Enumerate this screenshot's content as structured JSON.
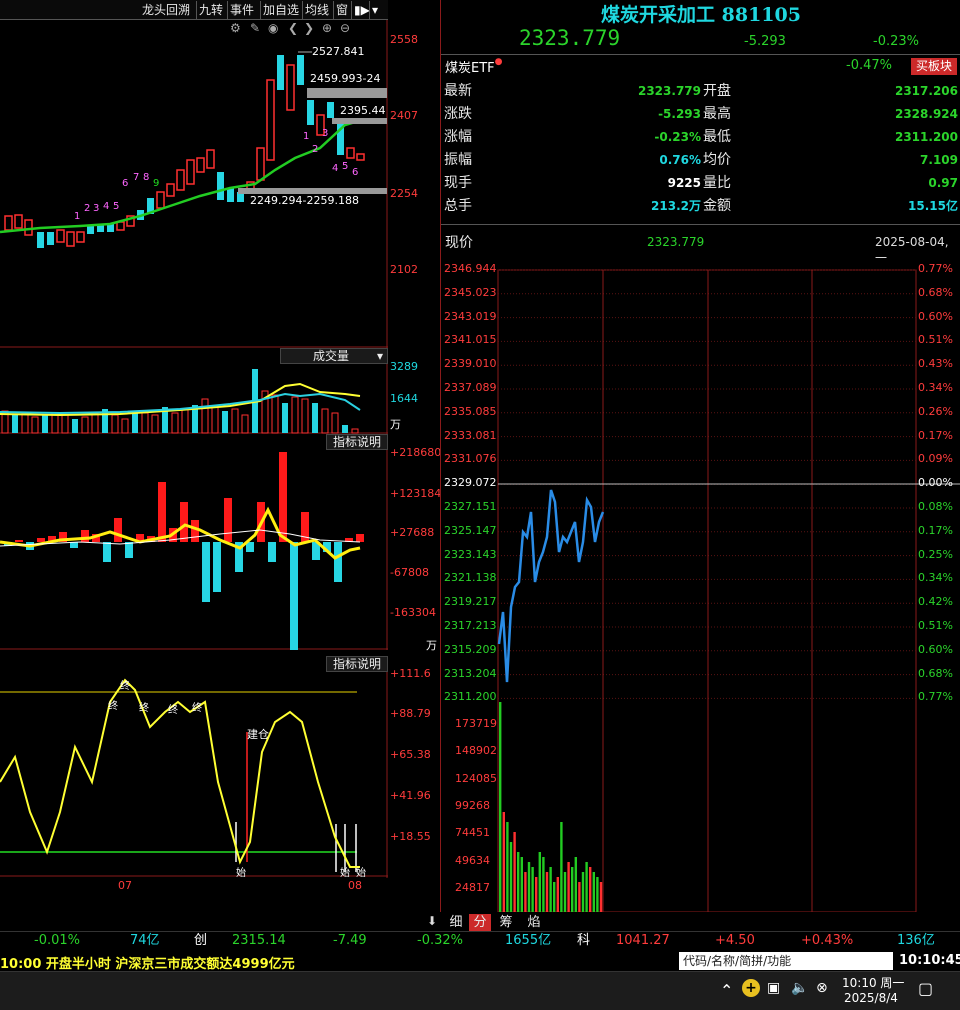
{
  "toolbar": {
    "buttons": [
      "龙头回溯",
      "九转",
      "事件",
      "加自选",
      "均线",
      "窗"
    ],
    "icons": [
      "gear-icon",
      "pen-icon",
      "eye-icon",
      "prev-icon",
      "next-icon",
      "zoom-in-icon",
      "zoom-out-icon"
    ]
  },
  "kline": {
    "price_axis": [
      "2558",
      "2407",
      "2254",
      "2102"
    ],
    "annotations": {
      "high": "2527.841",
      "box_top": "2459.993-24",
      "box_mid": "2395.44",
      "box_low": "2249.294-2259.188"
    },
    "nine_turn_labels": [
      "1",
      "2",
      "3",
      "4",
      "5",
      "6",
      "7",
      "8",
      "9",
      "1",
      "2",
      "3",
      "4",
      "5",
      "6"
    ]
  },
  "volume": {
    "title": "成交量",
    "axis": [
      "3289",
      "1644"
    ],
    "unit": "万"
  },
  "indicator1": {
    "title": "指标说明",
    "axis": [
      "+218680",
      "+123184",
      "+27688",
      "-67808",
      "-163304"
    ],
    "unit": "万"
  },
  "indicator2": {
    "title": "指标说明",
    "axis": [
      "+111.6",
      "+88.79",
      "+65.38",
      "+41.96",
      "+18.55"
    ],
    "marks": [
      "终",
      "终",
      "终",
      "终",
      "终",
      "建仓",
      "始",
      "始",
      "始"
    ]
  },
  "x_axis": [
    "07",
    "08"
  ],
  "quote": {
    "name": "煤炭开采加工 881105",
    "price": "2323.779",
    "change": "-5.293",
    "change_pct": "-0.23%",
    "etf_name": "煤炭ETF",
    "etf_pct": "-0.47%",
    "buy_block": "买板块",
    "rows": [
      {
        "l1": "最新",
        "v1": "2323.779",
        "c1": "green",
        "l2": "开盘",
        "v2": "2317.206",
        "c2": "green"
      },
      {
        "l1": "涨跌",
        "v1": "-5.293",
        "c1": "green",
        "l2": "最高",
        "v2": "2328.924",
        "c2": "green"
      },
      {
        "l1": "涨幅",
        "v1": "-0.23%",
        "c1": "green",
        "l2": "最低",
        "v2": "2311.200",
        "c2": "green"
      },
      {
        "l1": "振幅",
        "v1": "0.76%",
        "c1": "cyan",
        "l2": "均价",
        "v2": "7.109",
        "c2": "green"
      },
      {
        "l1": "现手",
        "v1": "9225",
        "c1": "white",
        "l2": "量比",
        "v2": "0.97",
        "c2": "green"
      },
      {
        "l1": "总手",
        "v1": "213.2万",
        "c1": "cyan",
        "l2": "金额",
        "v2": "15.15亿",
        "c2": "cyan"
      }
    ],
    "now_label": "现价",
    "now_price": "2323.779",
    "date": "2025-08-04,一"
  },
  "intraday": {
    "price_axis": [
      "2346.944",
      "2345.023",
      "2343.019",
      "2341.015",
      "2339.010",
      "2337.089",
      "2335.085",
      "2333.081",
      "2331.076",
      "2329.072",
      "2327.151",
      "2325.147",
      "2323.143",
      "2321.138",
      "2319.217",
      "2317.213",
      "2315.209",
      "2313.204",
      "2311.200"
    ],
    "pct_axis": [
      "0.77%",
      "0.68%",
      "0.60%",
      "0.51%",
      "0.43%",
      "0.34%",
      "0.26%",
      "0.17%",
      "0.09%",
      "0.00%",
      "0.08%",
      "0.17%",
      "0.25%",
      "0.34%",
      "0.42%",
      "0.51%",
      "0.60%",
      "0.68%",
      "0.77%"
    ],
    "vol_axis": [
      "173719",
      "148902",
      "124085",
      "99268",
      "74451",
      "49634",
      "24817"
    ]
  },
  "bottom_tabs": [
    "细",
    "分",
    "筹",
    "焰"
  ],
  "status_bar": {
    "items": [
      "-0.01%",
      "74亿",
      "创",
      "2315.14",
      "-7.49",
      "-0.32%",
      "1655亿",
      "科",
      "1041.27",
      "+4.50",
      "+0.43%",
      "136亿"
    ]
  },
  "news": {
    "headline": "10:00 开盘半小时 沪深京三市成交额达4999亿元",
    "search_placeholder": "代码/名称/简拼/功能",
    "clock": "10:10:45"
  },
  "taskbar": {
    "time": "10:10 周一",
    "date": "2025/8/4"
  },
  "colors": {
    "up": "#ff3c3c",
    "down": "#2bd42b",
    "cyan": "#1fd8e0",
    "grid": "#8a1a1a"
  }
}
